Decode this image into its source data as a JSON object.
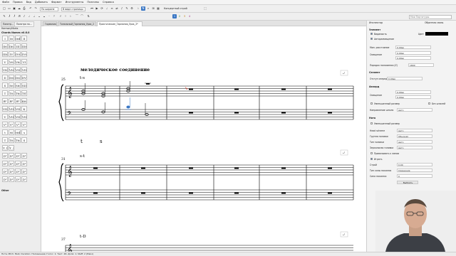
{
  "menu": [
    "Файл",
    "Правка",
    "Вид",
    "Добавить",
    "Формат",
    "Инструменты",
    "Плагины",
    "Справка"
  ],
  "toolbar": {
    "zoom_value": "По ширине",
    "view_mode": "В виде страницы",
    "concert_pitch_label": "Концертный строй",
    "voice_buttons": [
      "1",
      "2",
      "3",
      "4"
    ],
    "search_placeholder": "Мои Партитуры"
  },
  "left_panel": {
    "tabs": [
      "Палитр...",
      "Палитра по..."
    ],
    "heading": "HarmonyMarks",
    "palette_title": "Chords Names v0.6.0",
    "cells": [
      [
        "I",
        "I6",
        "I64",
        "II"
      ],
      [
        "II6",
        "II64",
        "III",
        "III6"
      ],
      [
        "III64",
        "IV",
        "IV6",
        "IV64"
      ],
      [
        "V",
        "V6",
        "V64",
        "VI"
      ],
      [
        "VI6",
        "VI64",
        "VII",
        "VII6"
      ],
      [
        "D",
        "D6",
        "D64",
        "DVI"
      ],
      [
        "S",
        "S6",
        "S64",
        "SII"
      ],
      [
        "T",
        "T6",
        "T64",
        "TSVI"
      ],
      [
        "Bᵇ",
        "Bᵇ",
        "Bᵇ",
        "K64"
      ],
      [
        "VII",
        "VII6",
        "VII64",
        "K"
      ],
      [
        "V",
        "VII",
        "VII6",
        "VII64"
      ],
      [
        "Vᵇ",
        "Vᵇ",
        "Vᵇ",
        "Vᵇ"
      ],
      [
        "t",
        "t6",
        "t64",
        "s"
      ],
      [
        "T",
        "T6",
        "T64",
        "S"
      ],
      [
        "T_1",
        "T_3",
        "",
        ""
      ],
      [
        "Dᵇ",
        "Dᵇ",
        "Dᵇ",
        "Dᵇ"
      ],
      [
        "Dᵇ",
        "Dᵇ",
        "Dᵇ",
        "Dᵇ"
      ],
      [
        "Dᵇ",
        "Dᵇ",
        "Dᵇ",
        "Dᵇ"
      ],
      [
        "Dᵇ",
        "Dᵇ",
        "Dᵇ",
        "Dᵇ"
      ]
    ],
    "other_label": "Other"
  },
  "score_tabs": [
    "Гармония",
    "Тональный_Гармония_Урок_2",
    "Практические_Гармония_Урок_2*"
  ],
  "score": {
    "title": "мелодическое соединение",
    "systems": [
      {
        "measure": "25",
        "top_label": "t-s",
        "bottom_labels": [
          "t",
          "s"
        ]
      },
      {
        "measure": "31",
        "top_label": "s-t",
        "bottom_labels": []
      },
      {
        "measure": "37",
        "top_label": "t-D",
        "bottom_labels": []
      }
    ]
  },
  "inspector": {
    "title": "Инспектор",
    "element_header": "Элемент",
    "visible_label": "Видимость",
    "color_label": "Цвет",
    "auto_place_label": "Автоpазмещение",
    "min_distance_label": "Мин. расстояние",
    "min_distance_value": "0.00sp",
    "offset_label": "Смещение",
    "offset_x": "0.00sp",
    "offset_y": "0.00sp",
    "stacking_label": "Порядок наложения (Z)",
    "stacking_value": "1800",
    "segment_header": "Сегмент",
    "leading_label": "Отступ спереди",
    "leading_value": "0.00sp",
    "chord_header": "Аккорд",
    "chord_offset_x": "0.00sp",
    "chord_offset_y": "0.00sp",
    "small_label": "Уменьшенный размер",
    "no_stem_label": "Без штилей",
    "stem_dir_label": "Направление штиля",
    "stem_dir_value": "Авто",
    "note_header": "Нота",
    "small_note_label": "Уменьшенный размер",
    "head_type_label": "Head scheme",
    "head_type_value": "Авто",
    "head_group_label": "Группа головки",
    "head_group_value": "Обычная",
    "head_kind_label": "Тип головки",
    "head_kind_value": "Авто",
    "mirror_label": "Зеркальная головка",
    "mirror_value": "Авто",
    "fix_line_label": "Привязывать к линии",
    "play_label": "Играть",
    "tuning_label": "Строй",
    "tuning_value": "0.00",
    "velocity_type_label": "Тип силы нажатия",
    "velocity_type_value": "Смещение",
    "velocity_label": "Сила нажатия",
    "velocity_value": "0",
    "select_label": "Выбрать",
    "beam_label": "Обратная связь"
  },
  "status_bar": "Нота; Pitch: Ми4; Duration: Половинная; Голос: 1; Такт: 26; Доля: 1; Staff: 2 (Piano)"
}
